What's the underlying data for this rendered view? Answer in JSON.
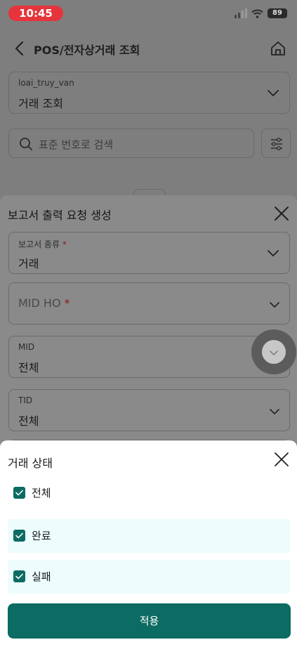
{
  "status_bar": {
    "time": "10:45",
    "battery": "89"
  },
  "nav": {
    "title": "POS/전자상거래 조회"
  },
  "query_type": {
    "label": "loai_truy_van",
    "value": "거래 조회"
  },
  "search": {
    "placeholder": "표준 번호로 검색"
  },
  "report_sheet": {
    "title": "보고서 출력 요청 생성",
    "fields": [
      {
        "label": "보고서 종류",
        "required_mark": "*",
        "value": "거래"
      },
      {
        "label": "MID HO",
        "required_mark": "*",
        "value": ""
      },
      {
        "label": "MID",
        "value": "전체"
      },
      {
        "label": "TID",
        "value": "전체"
      }
    ]
  },
  "status_sheet": {
    "title": "거래 상태",
    "options": [
      {
        "label": "전체",
        "checked": true
      },
      {
        "label": "완료",
        "checked": true
      },
      {
        "label": "실패",
        "checked": true
      }
    ],
    "apply_label": "적용"
  },
  "colors": {
    "accent": "#0c6b62",
    "time_pill": "#e5343b",
    "highlight": "#edfcfc"
  }
}
